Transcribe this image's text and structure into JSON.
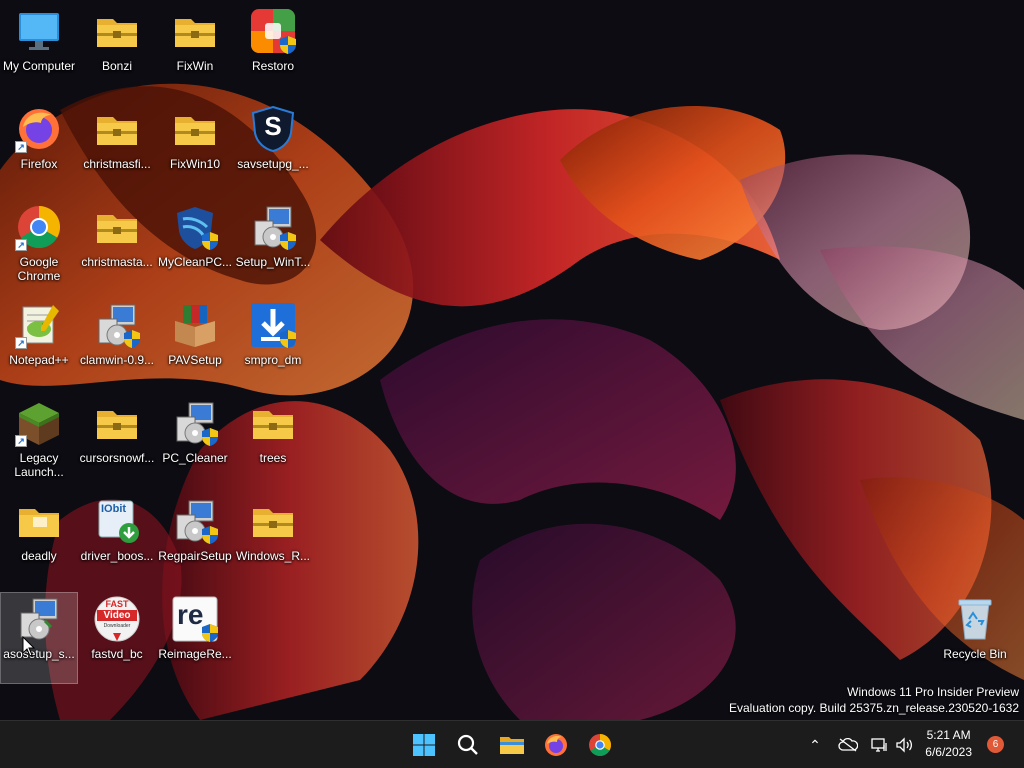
{
  "desktop": {
    "icons": [
      {
        "label": "My Computer"
      },
      {
        "label": "Bonzi"
      },
      {
        "label": "FixWin"
      },
      {
        "label": "Restoro"
      },
      {
        "label": "Firefox"
      },
      {
        "label": "christmasfi..."
      },
      {
        "label": "FixWin10"
      },
      {
        "label": "savsetupg_..."
      },
      {
        "label": "Google Chrome"
      },
      {
        "label": "christmasta..."
      },
      {
        "label": "MyCleanPC..."
      },
      {
        "label": "Setup_WinT..."
      },
      {
        "label": "Notepad++"
      },
      {
        "label": "clamwin-0.9..."
      },
      {
        "label": "PAVSetup"
      },
      {
        "label": "smpro_dm"
      },
      {
        "label": "Legacy Launch..."
      },
      {
        "label": "cursorsnowf..."
      },
      {
        "label": "PC_Cleaner"
      },
      {
        "label": "trees"
      },
      {
        "label": "deadly"
      },
      {
        "label": "driver_boos..."
      },
      {
        "label": "RegpairSetup"
      },
      {
        "label": "Windows_R..."
      },
      {
        "label": "asosetup_s..."
      },
      {
        "label": "fastvd_bc"
      },
      {
        "label": "ReimageRe..."
      },
      {
        "label": "Recycle Bin"
      }
    ],
    "icon_text": {
      "iobit": "IObit",
      "fast_line1": "FAST",
      "fast_line2": "Video",
      "fast_line3": "Downloader",
      "reimage": "re",
      "savs": "S",
      "shortcut_arrow": "↗"
    }
  },
  "watermark": {
    "line1": "Windows 11 Pro Insider Preview",
    "line2": "Evaluation copy. Build 25375.zn_release.230520-1632"
  },
  "taskbar": {
    "clock": {
      "time": "5:21 AM",
      "date": "6/6/2023"
    },
    "notification_count": "6",
    "tray_chevron": "⌃",
    "colors": {
      "background": "#1c1c1c",
      "start_blue": "#4cc2ff",
      "folder_yellow": "#f7c948",
      "badge": "#e05a38"
    }
  }
}
